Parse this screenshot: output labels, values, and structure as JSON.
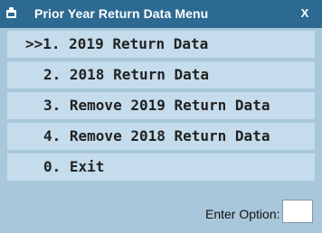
{
  "window": {
    "title": "Prior Year Return Data Menu",
    "close_label": "X",
    "colors": {
      "titlebar": "#2d6a92",
      "background": "#a9c7da",
      "menu_item": "#c4dceb"
    }
  },
  "menu": {
    "items": [
      {
        "label": ">>1. 2019 Return Data",
        "selected": true
      },
      {
        "label": "2. 2018 Return Data",
        "selected": false
      },
      {
        "label": "3. Remove 2019 Return Data",
        "selected": false
      },
      {
        "label": "4. Remove 2018 Return Data",
        "selected": false
      },
      {
        "label": "0. Exit",
        "selected": false
      }
    ]
  },
  "footer": {
    "option_label": "Enter Option:",
    "option_value": ""
  }
}
